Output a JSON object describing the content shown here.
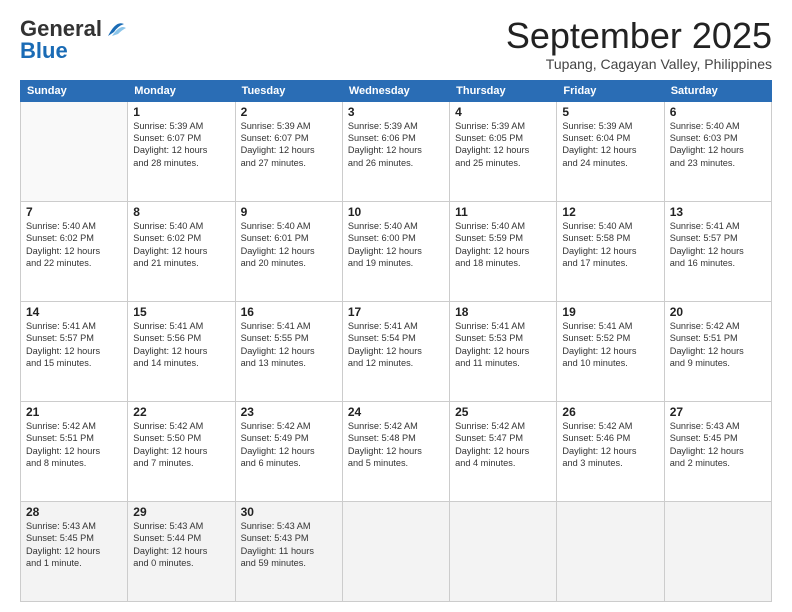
{
  "header": {
    "logo_general": "General",
    "logo_blue": "Blue",
    "month_title": "September 2025",
    "subtitle": "Tupang, Cagayan Valley, Philippines"
  },
  "days_of_week": [
    "Sunday",
    "Monday",
    "Tuesday",
    "Wednesday",
    "Thursday",
    "Friday",
    "Saturday"
  ],
  "weeks": [
    [
      {
        "day": "",
        "info": ""
      },
      {
        "day": "1",
        "info": "Sunrise: 5:39 AM\nSunset: 6:07 PM\nDaylight: 12 hours\nand 28 minutes."
      },
      {
        "day": "2",
        "info": "Sunrise: 5:39 AM\nSunset: 6:07 PM\nDaylight: 12 hours\nand 27 minutes."
      },
      {
        "day": "3",
        "info": "Sunrise: 5:39 AM\nSunset: 6:06 PM\nDaylight: 12 hours\nand 26 minutes."
      },
      {
        "day": "4",
        "info": "Sunrise: 5:39 AM\nSunset: 6:05 PM\nDaylight: 12 hours\nand 25 minutes."
      },
      {
        "day": "5",
        "info": "Sunrise: 5:39 AM\nSunset: 6:04 PM\nDaylight: 12 hours\nand 24 minutes."
      },
      {
        "day": "6",
        "info": "Sunrise: 5:40 AM\nSunset: 6:03 PM\nDaylight: 12 hours\nand 23 minutes."
      }
    ],
    [
      {
        "day": "7",
        "info": "Sunrise: 5:40 AM\nSunset: 6:02 PM\nDaylight: 12 hours\nand 22 minutes."
      },
      {
        "day": "8",
        "info": "Sunrise: 5:40 AM\nSunset: 6:02 PM\nDaylight: 12 hours\nand 21 minutes."
      },
      {
        "day": "9",
        "info": "Sunrise: 5:40 AM\nSunset: 6:01 PM\nDaylight: 12 hours\nand 20 minutes."
      },
      {
        "day": "10",
        "info": "Sunrise: 5:40 AM\nSunset: 6:00 PM\nDaylight: 12 hours\nand 19 minutes."
      },
      {
        "day": "11",
        "info": "Sunrise: 5:40 AM\nSunset: 5:59 PM\nDaylight: 12 hours\nand 18 minutes."
      },
      {
        "day": "12",
        "info": "Sunrise: 5:40 AM\nSunset: 5:58 PM\nDaylight: 12 hours\nand 17 minutes."
      },
      {
        "day": "13",
        "info": "Sunrise: 5:41 AM\nSunset: 5:57 PM\nDaylight: 12 hours\nand 16 minutes."
      }
    ],
    [
      {
        "day": "14",
        "info": "Sunrise: 5:41 AM\nSunset: 5:57 PM\nDaylight: 12 hours\nand 15 minutes."
      },
      {
        "day": "15",
        "info": "Sunrise: 5:41 AM\nSunset: 5:56 PM\nDaylight: 12 hours\nand 14 minutes."
      },
      {
        "day": "16",
        "info": "Sunrise: 5:41 AM\nSunset: 5:55 PM\nDaylight: 12 hours\nand 13 minutes."
      },
      {
        "day": "17",
        "info": "Sunrise: 5:41 AM\nSunset: 5:54 PM\nDaylight: 12 hours\nand 12 minutes."
      },
      {
        "day": "18",
        "info": "Sunrise: 5:41 AM\nSunset: 5:53 PM\nDaylight: 12 hours\nand 11 minutes."
      },
      {
        "day": "19",
        "info": "Sunrise: 5:41 AM\nSunset: 5:52 PM\nDaylight: 12 hours\nand 10 minutes."
      },
      {
        "day": "20",
        "info": "Sunrise: 5:42 AM\nSunset: 5:51 PM\nDaylight: 12 hours\nand 9 minutes."
      }
    ],
    [
      {
        "day": "21",
        "info": "Sunrise: 5:42 AM\nSunset: 5:51 PM\nDaylight: 12 hours\nand 8 minutes."
      },
      {
        "day": "22",
        "info": "Sunrise: 5:42 AM\nSunset: 5:50 PM\nDaylight: 12 hours\nand 7 minutes."
      },
      {
        "day": "23",
        "info": "Sunrise: 5:42 AM\nSunset: 5:49 PM\nDaylight: 12 hours\nand 6 minutes."
      },
      {
        "day": "24",
        "info": "Sunrise: 5:42 AM\nSunset: 5:48 PM\nDaylight: 12 hours\nand 5 minutes."
      },
      {
        "day": "25",
        "info": "Sunrise: 5:42 AM\nSunset: 5:47 PM\nDaylight: 12 hours\nand 4 minutes."
      },
      {
        "day": "26",
        "info": "Sunrise: 5:42 AM\nSunset: 5:46 PM\nDaylight: 12 hours\nand 3 minutes."
      },
      {
        "day": "27",
        "info": "Sunrise: 5:43 AM\nSunset: 5:45 PM\nDaylight: 12 hours\nand 2 minutes."
      }
    ],
    [
      {
        "day": "28",
        "info": "Sunrise: 5:43 AM\nSunset: 5:45 PM\nDaylight: 12 hours\nand 1 minute."
      },
      {
        "day": "29",
        "info": "Sunrise: 5:43 AM\nSunset: 5:44 PM\nDaylight: 12 hours\nand 0 minutes."
      },
      {
        "day": "30",
        "info": "Sunrise: 5:43 AM\nSunset: 5:43 PM\nDaylight: 11 hours\nand 59 minutes."
      },
      {
        "day": "",
        "info": ""
      },
      {
        "day": "",
        "info": ""
      },
      {
        "day": "",
        "info": ""
      },
      {
        "day": "",
        "info": ""
      }
    ]
  ]
}
